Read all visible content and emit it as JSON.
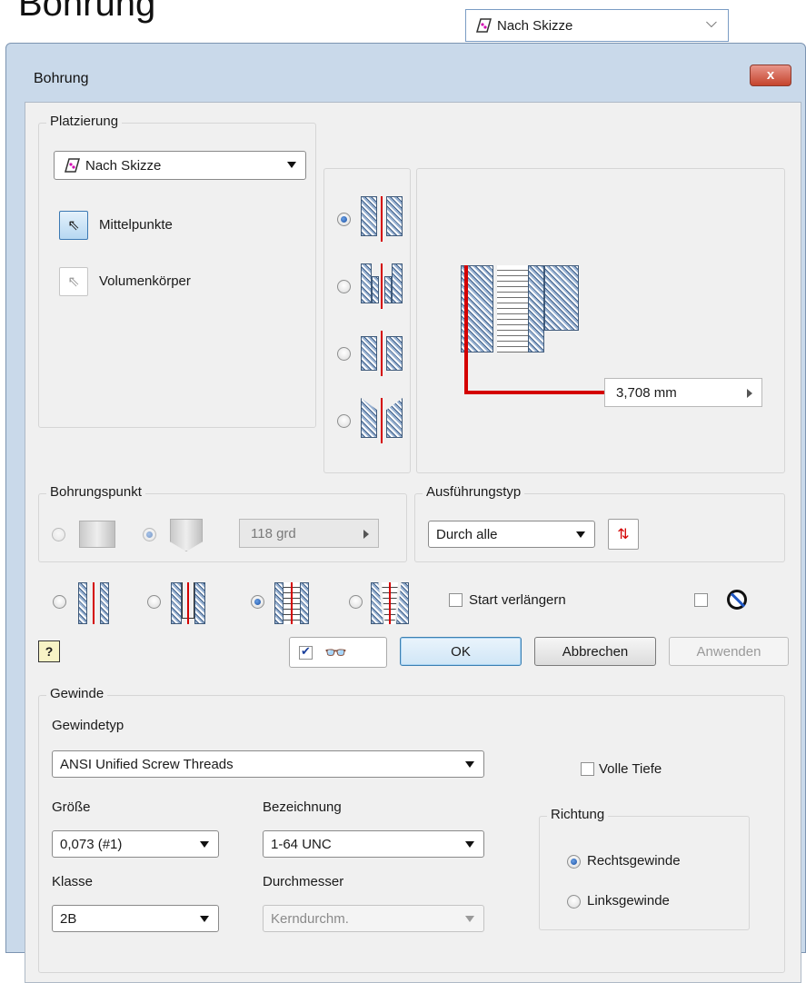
{
  "page": {
    "heading": "Bohrung"
  },
  "top_combo": {
    "value": "Nach Skizze"
  },
  "dialog": {
    "title": "Bohrung",
    "close_symbol": "x",
    "placement": {
      "title": "Platzierung",
      "mode": "Nach Skizze",
      "centers_label": "Mittelpunkte",
      "solid_label": "Volumenkörper"
    },
    "hole_types": {
      "selected_index": 0,
      "count": 4
    },
    "preview": {
      "depth_value": "3,708 mm"
    },
    "drill_point": {
      "title": "Bohrungspunkt",
      "angle": "118 grd",
      "selected": "angled"
    },
    "termination": {
      "title": "Ausführungstyp",
      "value": "Durch alle"
    },
    "thread_types": {
      "selected_index": 2,
      "extend_start_label": "Start verlängern"
    },
    "preview_checked": true,
    "buttons": {
      "help": "?",
      "ok": "OK",
      "cancel": "Abbrechen",
      "apply": "Anwenden"
    },
    "thread": {
      "title": "Gewinde",
      "type_label": "Gewindetyp",
      "type_value": "ANSI Unified Screw Threads",
      "full_depth_label": "Volle Tiefe",
      "size_label": "Größe",
      "size_value": "0,073 (#1)",
      "designation_label": "Bezeichnung",
      "designation_value": "1-64 UNC",
      "class_label": "Klasse",
      "class_value": "2B",
      "diameter_label": "Durchmesser",
      "diameter_value": "Kerndurchm.",
      "direction": {
        "title": "Richtung",
        "right_label": "Rechtsgewinde",
        "left_label": "Linksgewinde",
        "selected": "right"
      }
    }
  },
  "colors": {
    "accent_red": "#d40000",
    "selection_blue": "#1a4fa0",
    "dialog_frame": "#c9d9ea"
  }
}
